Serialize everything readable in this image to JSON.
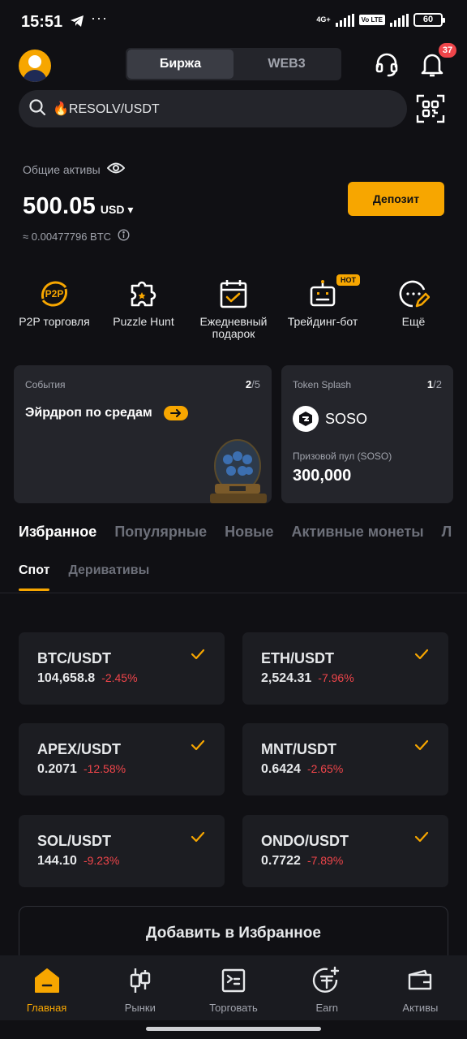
{
  "status_bar": {
    "time": "15:51",
    "network": "4G+",
    "volte": "Vo LTE",
    "battery": "60"
  },
  "header": {
    "tabs": [
      {
        "label": "Биржа",
        "active": true
      },
      {
        "label": "WEB3",
        "active": false
      }
    ],
    "notification_count": "37"
  },
  "search": {
    "placeholder": "🔥RESOLV/USDT"
  },
  "assets": {
    "label": "Общие активы",
    "value": "500.05",
    "currency": "USD",
    "btc_equiv": "≈ 0.00477796 BTC",
    "deposit_label": "Депозит"
  },
  "quick_actions": [
    {
      "label": "P2P торговля",
      "icon": "p2p-icon"
    },
    {
      "label": "Puzzle Hunt",
      "icon": "puzzle-icon"
    },
    {
      "label": "Ежедневный подарок",
      "icon": "calendar-check-icon"
    },
    {
      "label": "Трейдинг-бот",
      "icon": "robot-icon",
      "badge": "HOT"
    },
    {
      "label": "Ещё",
      "icon": "more-icon"
    }
  ],
  "cards": {
    "events": {
      "category": "События",
      "page": "2",
      "total": "/5",
      "title": "Эйрдроп по средам"
    },
    "token_splash": {
      "category": "Token Splash",
      "page": "1",
      "total": "/2",
      "token": "SOSO",
      "pool_label": "Призовой пул (SOSO)",
      "pool_value": "300,000"
    }
  },
  "market_tabs": [
    {
      "label": "Избранное",
      "active": true
    },
    {
      "label": "Популярные",
      "active": false
    },
    {
      "label": "Новые",
      "active": false
    },
    {
      "label": "Активные монеты",
      "active": false
    },
    {
      "label": "Л",
      "active": false
    }
  ],
  "sub_tabs": [
    {
      "label": "Спот",
      "active": true
    },
    {
      "label": "Деривативы",
      "active": false
    }
  ],
  "favorites": [
    {
      "pair": "BTC/USDT",
      "price": "104,658.8",
      "change": "-2.45%"
    },
    {
      "pair": "ETH/USDT",
      "price": "2,524.31",
      "change": "-7.96%"
    },
    {
      "pair": "APEX/USDT",
      "price": "0.2071",
      "change": "-12.58%"
    },
    {
      "pair": "MNT/USDT",
      "price": "0.6424",
      "change": "-2.65%"
    },
    {
      "pair": "SOL/USDT",
      "price": "144.10",
      "change": "-9.23%"
    },
    {
      "pair": "ONDO/USDT",
      "price": "0.7722",
      "change": "-7.89%"
    }
  ],
  "add_favorites_label": "Добавить в Избранное",
  "bottom_nav": [
    {
      "label": "Главная",
      "icon": "home-icon",
      "active": true
    },
    {
      "label": "Рынки",
      "icon": "candlestick-icon",
      "active": false
    },
    {
      "label": "Торговать",
      "icon": "trade-icon",
      "active": false
    },
    {
      "label": "Earn",
      "icon": "earn-icon",
      "active": false
    },
    {
      "label": "Активы",
      "icon": "wallet-icon",
      "active": false
    }
  ],
  "colors": {
    "accent": "#f7a600",
    "negative": "#ef454a",
    "background": "#101014",
    "card": "#24252b"
  }
}
